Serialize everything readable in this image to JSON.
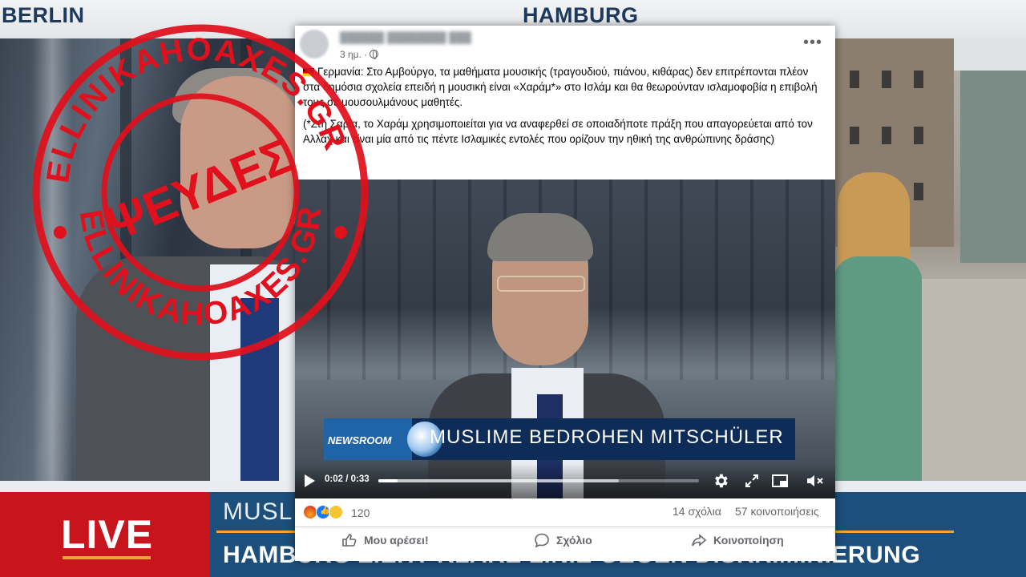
{
  "background": {
    "city_left": "BERLIN",
    "city_right": "HAMBURG",
    "live_label": "LIVE",
    "ticker_headline_top": "MUSL",
    "ticker_headline_bottom": "HAMBURG ZIEHT KLARE LINIE GEGEN DISKRIMINIERUNG"
  },
  "stamp": {
    "ring_text_top": "ELLINIKAHOAXES.GR",
    "ring_text_bottom": "ELLINIKAHOAXES.GR",
    "center_text": "ΨΕΥΔΕΣ",
    "color": "#e0101c"
  },
  "post": {
    "time": "3 ημ.",
    "paragraphs": [
      "Γερμανία: Στο Αμβούργο, τα μαθήματα μουσικής (τραγουδιού, πιάνου, κιθάρας) δεν επιτρέπονται πλέον στα δημόσια σχολεία επειδή η μουσική είναι «Χαράμ*» στο Ισλάμ και θα θεωρούνταν ισλαμοφοβία η επιβολή τους σε μουσουλμάνους μαθητές.",
      "(*Στη Σαρία, το Χαράμ χρησιμοποιείται για να αναφερθεί σε οποιαδήποτε πράξη που απαγορεύεται από τον Αλλάχ και είναι μία από τις πέντε Ισλαμικές εντολές που ορίζουν την ηθική της ανθρώπινης δράσης)"
    ],
    "video": {
      "newsroom_label": "NEWSROOM",
      "ticker_text": "MUSLIME BEDROHEN MITSCHÜLER",
      "time_readout": "0:02 / 0:33",
      "progress_fraction": 0.06,
      "buffer_fraction": 0.75
    },
    "reactions_count": "120",
    "comments_count": "14 σχόλια",
    "shares_count": "57 κοινοποιήσεις",
    "actions": {
      "like": "Μου αρέσει!",
      "comment": "Σχόλιο",
      "share": "Κοινοποίηση"
    }
  }
}
